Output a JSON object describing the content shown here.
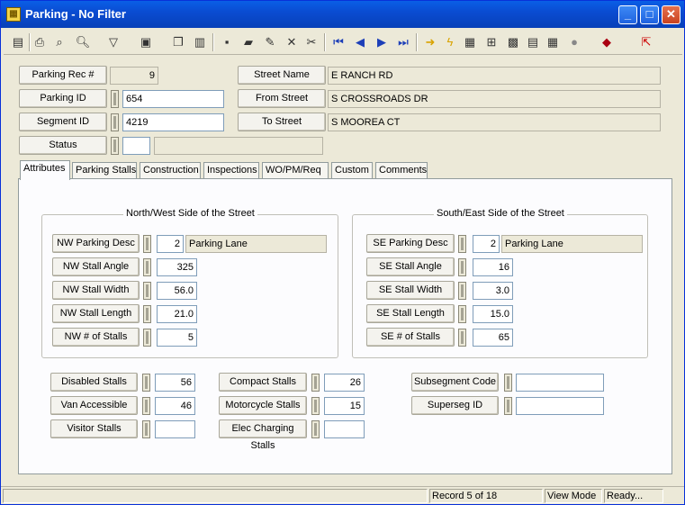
{
  "window": {
    "title": "Parking - No Filter"
  },
  "header": {
    "parking_rec_label": "Parking Rec #",
    "parking_rec_value": "9",
    "parking_id_label": "Parking ID",
    "parking_id_value": "654",
    "segment_id_label": "Segment ID",
    "segment_id_value": "4219",
    "status_label": "Status",
    "status_value": "",
    "status_desc": "",
    "street_name_label": "Street Name",
    "street_name_value": "E  RANCH RD",
    "from_street_label": "From Street",
    "from_street_value": "S  CROSSROADS DR",
    "to_street_label": "To Street",
    "to_street_value": "S  MOOREA CT"
  },
  "tabs": [
    {
      "label": "Attributes"
    },
    {
      "label": "Parking Stalls"
    },
    {
      "label": "Construction"
    },
    {
      "label": "Inspections"
    },
    {
      "label": "WO/PM/Req"
    },
    {
      "label": "Custom"
    },
    {
      "label": "Comments"
    }
  ],
  "nw": {
    "group_label": "North/West Side of the Street",
    "desc_label": "NW Parking Desc",
    "desc_code": "2",
    "desc_text": "Parking Lane",
    "angle_label": "NW Stall Angle",
    "angle_value": "325",
    "width_label": "NW Stall Width",
    "width_value": "56.0",
    "length_label": "NW Stall Length",
    "length_value": "21.0",
    "stalls_label": "NW # of Stalls",
    "stalls_value": "5"
  },
  "se": {
    "group_label": "South/East Side of the Street",
    "desc_label": "SE Parking Desc",
    "desc_code": "2",
    "desc_text": "Parking Lane",
    "angle_label": "SE Stall Angle",
    "angle_value": "16",
    "width_label": "SE Stall Width",
    "width_value": "3.0",
    "length_label": "SE Stall Length",
    "length_value": "15.0",
    "stalls_label": "SE # of Stalls",
    "stalls_value": "65"
  },
  "other": {
    "disabled_label": "Disabled Stalls",
    "disabled_value": "56",
    "van_label": "Van Accessible",
    "van_value": "46",
    "visitor_label": "Visitor Stalls",
    "visitor_value": "",
    "compact_label": "Compact Stalls",
    "compact_value": "26",
    "motorcycle_label": "Motorcycle Stalls",
    "motorcycle_value": "15",
    "elec_label": "Elec Charging Stalls",
    "elec_value": "",
    "subseg_label": "Subsegment Code",
    "subseg_value": "",
    "superseg_label": "Superseg ID",
    "superseg_value": ""
  },
  "status": {
    "record": "Record 5 of 18",
    "mode": "View Mode",
    "state": "Ready..."
  },
  "toolbar_icons": [
    "list-icon",
    "print-icon",
    "preview-icon",
    "search-icon",
    "filter-icon",
    "report-icon",
    "copy-icon",
    "disk-icon",
    "books-icon",
    "pencil-icon",
    "delete-icon",
    "cut-icon",
    "first-icon",
    "prev-icon",
    "next-icon",
    "last-icon",
    "goto-icon",
    "lightning-icon",
    "map-icon",
    "tree-icon",
    "chart-icon",
    "calc-icon",
    "grid-icon",
    "globe-icon",
    "book-icon",
    "exit-icon"
  ]
}
